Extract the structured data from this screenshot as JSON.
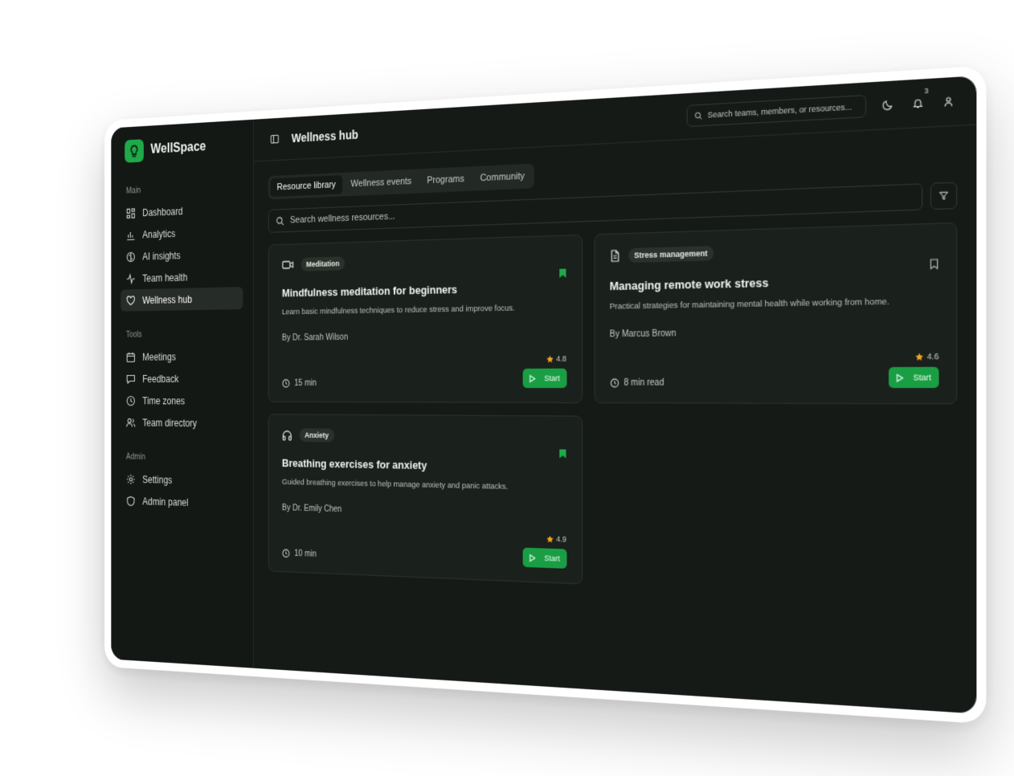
{
  "app": {
    "name": "WellSpace"
  },
  "sidebar": {
    "sections": [
      {
        "label": "Main",
        "items": [
          {
            "label": "Dashboard",
            "icon": "dashboard-icon"
          },
          {
            "label": "Analytics",
            "icon": "bar-chart-icon"
          },
          {
            "label": "AI insights",
            "icon": "brain-icon"
          },
          {
            "label": "Team health",
            "icon": "activity-icon"
          },
          {
            "label": "Wellness hub",
            "icon": "heart-icon",
            "active": true
          }
        ]
      },
      {
        "label": "Tools",
        "items": [
          {
            "label": "Meetings",
            "icon": "calendar-icon"
          },
          {
            "label": "Feedback",
            "icon": "message-icon"
          },
          {
            "label": "Time zones",
            "icon": "clock-icon"
          },
          {
            "label": "Team directory",
            "icon": "users-icon"
          }
        ]
      },
      {
        "label": "Admin",
        "items": [
          {
            "label": "Settings",
            "icon": "gear-icon"
          },
          {
            "label": "Admin panel",
            "icon": "shield-icon"
          }
        ]
      }
    ]
  },
  "header": {
    "title": "Wellness hub",
    "search_placeholder": "Search teams, members, or resources...",
    "notification_count": "3"
  },
  "tabs": [
    {
      "label": "Resource library",
      "active": true
    },
    {
      "label": "Wellness events"
    },
    {
      "label": "Programs"
    },
    {
      "label": "Community"
    }
  ],
  "search": {
    "placeholder": "Search wellness resources..."
  },
  "colors": {
    "accent": "#1a9e44",
    "star": "#f5a623",
    "background": "#151a16"
  },
  "cards": [
    {
      "icon": "video-icon",
      "tag": "Meditation",
      "title": "Mindfulness meditation for beginners",
      "description": "Learn basic mindfulness techniques to reduce stress and improve focus.",
      "author": "By Dr. Sarah Wilson",
      "duration": "15 min",
      "rating": "4.8",
      "bookmarked": true,
      "action": "Start"
    },
    {
      "icon": "document-icon",
      "tag": "Stress management",
      "title": "Managing remote work stress",
      "description": "Practical strategies for maintaining mental health while working from home.",
      "author": "By Marcus Brown",
      "duration": "8 min read",
      "rating": "4.6",
      "bookmarked": false,
      "action": "Start"
    },
    {
      "icon": "headphones-icon",
      "tag": "Anxiety",
      "title": "Breathing exercises for anxiety",
      "description": "Guided breathing exercises to help manage anxiety and panic attacks.",
      "author": "By Dr. Emily Chen",
      "duration": "10 min",
      "rating": "4.9",
      "bookmarked": true,
      "action": "Start"
    }
  ]
}
